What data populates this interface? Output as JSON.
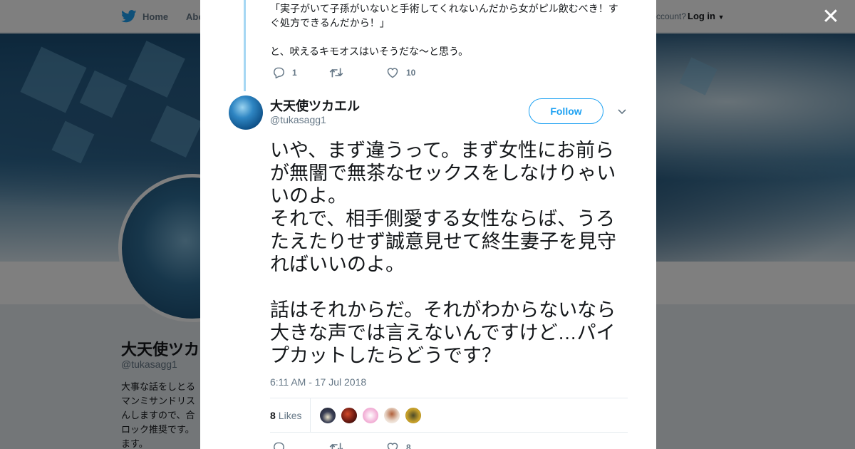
{
  "colors": {
    "accent": "#1da1f2",
    "text": "#14171a",
    "muted": "#657786",
    "rail": "#a5d7f3"
  },
  "nav": {
    "home_label": "Home",
    "about_label": "Abo",
    "account_label": "ccount?",
    "login_label": "Log in"
  },
  "profile": {
    "name": "大天使ツカエ",
    "handle": "@tukasagg1",
    "bio": "大事な話をしとる\nマンミサンドリス\nんしますので、合\nロック推奨です。\nます。"
  },
  "parent_tweet": {
    "line1": "「実子がいて子孫がいないと手術してくれないんだから女がピル飲むべき！すぐ処方できるんだから！」",
    "line2": "と、吠えるキモオスはいそうだな～と思う。",
    "replies": "1",
    "retweets": "",
    "likes": "10"
  },
  "tweet": {
    "author_name": "大天使ツカエル",
    "author_handle": "@tukasagg1",
    "follow_label": "Follow",
    "text": "いや、まず違うって。まず女性にお前らが無闇で無茶なセックスをしなけりゃいいのよ。\nそれで、相手側愛する女性ならば、うろたえたりせず誠意見せて終生妻子を見守ればいいのよ。\n\n話はそれからだ。それがわからないなら大きな声では言えないんですけど…パイプカットしたらどうです？",
    "timestamp": "6:11 AM - 17 Jul 2018",
    "likes_count": "8",
    "likes_label": "Likes",
    "likers": [
      {
        "icon": "liker-avatar-1",
        "color": "#3a3f55"
      },
      {
        "icon": "liker-avatar-2",
        "color": "#6b1a12"
      },
      {
        "icon": "liker-avatar-3",
        "color": "#f3b3d8"
      },
      {
        "icon": "liker-avatar-4",
        "color": "#e8d6c8"
      },
      {
        "icon": "liker-avatar-5",
        "color": "#c9a22a"
      }
    ],
    "bottom_replies": "",
    "bottom_retweets": "",
    "bottom_likes": "8"
  },
  "icons": {
    "logo": "twitter-bird-icon",
    "close": "close-icon",
    "reply": "reply-icon",
    "retweet": "retweet-icon",
    "like": "heart-icon",
    "caret": "chevron-down-icon"
  }
}
